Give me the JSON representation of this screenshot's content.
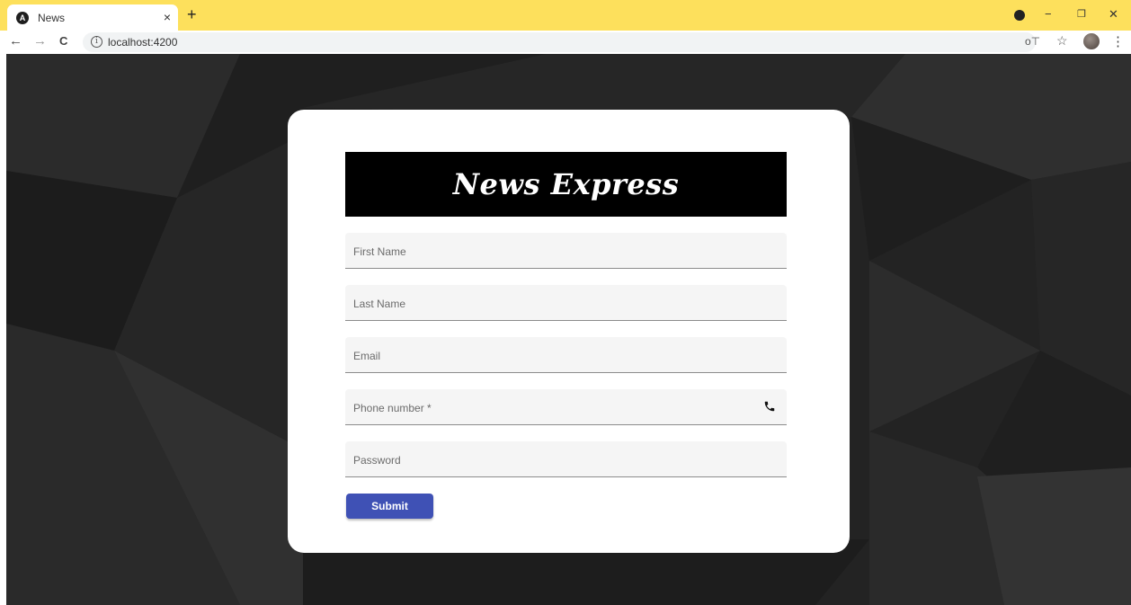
{
  "browser": {
    "tab_title": "News",
    "tab_favicon_letter": "A",
    "tab_close": "×",
    "new_tab": "+",
    "url": "localhost:4200",
    "info_icon": "i",
    "back": "←",
    "forward": "→",
    "reload": "C",
    "minimize": "−",
    "restore": "❐",
    "close": "✕",
    "key_icon": "o⊤",
    "star_icon": "☆",
    "menu_icon": "⋮",
    "tabstrip_color": "#fde05c"
  },
  "page": {
    "banner_title": "News Express",
    "fields": [
      {
        "label": "First Name"
      },
      {
        "label": "Last Name"
      },
      {
        "label": "Email"
      },
      {
        "label": "Phone number *",
        "icon": "phone-icon"
      },
      {
        "label": "Password"
      }
    ],
    "submit_label": "Submit",
    "accent_color": "#3f51b5",
    "background_color": "#232323"
  }
}
